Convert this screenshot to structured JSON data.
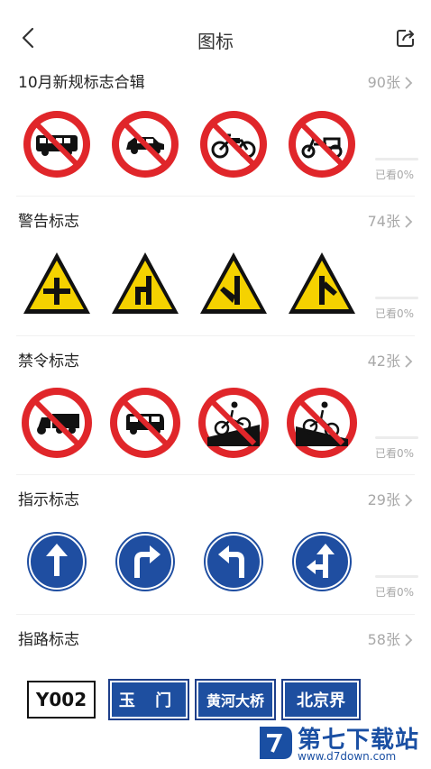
{
  "header": {
    "title": "图标"
  },
  "sections": [
    {
      "title": "10月新规标志合辑",
      "count": "90张",
      "progress_text": "已看0%",
      "progress": 0,
      "signs": [
        "no-bus-sign",
        "no-car-sign",
        "no-motorcycle-sign",
        "no-tricycle-sign"
      ]
    },
    {
      "title": "警告标志",
      "count": "74张",
      "progress_text": "已看0%",
      "progress": 0,
      "signs": [
        "crossroad-warning-sign",
        "side-road-warning-sign",
        "side-road-left-warning-sign",
        "merge-warning-sign"
      ]
    },
    {
      "title": "禁令标志",
      "count": "42张",
      "progress_text": "已看0%",
      "progress": 0,
      "signs": [
        "no-tractor-sign",
        "no-van-sign",
        "no-bicycle-downhill-sign",
        "no-bicycle-uphill-sign"
      ]
    },
    {
      "title": "指示标志",
      "count": "29张",
      "progress_text": "已看0%",
      "progress": 0,
      "signs": [
        "straight-ahead-sign",
        "turn-right-sign",
        "turn-left-sign",
        "straight-or-left-sign"
      ]
    },
    {
      "title": "指路标志",
      "count": "58张",
      "guides": [
        "Y002",
        "玉 门",
        "黄河大桥",
        "北京界"
      ]
    }
  ],
  "watermark": {
    "title": "第七下载站",
    "url": "www.d7down.com"
  },
  "colors": {
    "prohibit_red": "#e0262a",
    "warning_yellow": "#f5d200",
    "mandatory_blue": "#1f4ea1",
    "accent": "#4a90e2"
  }
}
